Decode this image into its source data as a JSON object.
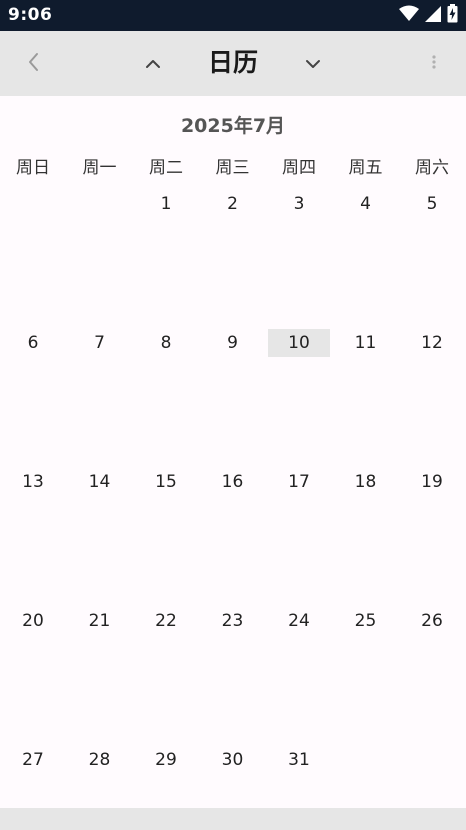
{
  "status_bar": {
    "time": "9:06",
    "icons": [
      "wifi-icon",
      "cellular-signal-icon",
      "battery-charging-icon"
    ]
  },
  "toolbar": {
    "title": "日历",
    "back_icon": "chevron-left-icon",
    "prev_icon": "chevron-up-icon",
    "next_icon": "chevron-down-icon",
    "menu_icon": "more-vert-icon"
  },
  "calendar": {
    "month_title": "2025年7月",
    "weekdays": [
      "周日",
      "周一",
      "周二",
      "周三",
      "周四",
      "周五",
      "周六"
    ],
    "first_weekday_index": 2,
    "days_in_month": 31,
    "highlighted_day": 10,
    "weeks": [
      [
        "",
        "",
        "1",
        "2",
        "3",
        "4",
        "5"
      ],
      [
        "6",
        "7",
        "8",
        "9",
        "10",
        "11",
        "12"
      ],
      [
        "13",
        "14",
        "15",
        "16",
        "17",
        "18",
        "19"
      ],
      [
        "20",
        "21",
        "22",
        "23",
        "24",
        "25",
        "26"
      ],
      [
        "27",
        "28",
        "29",
        "30",
        "31",
        "",
        ""
      ]
    ]
  },
  "colors": {
    "status_bar_bg": "#0f1b2d",
    "toolbar_bg": "#e6e6e6",
    "page_bg": "#fffbfe",
    "highlight_bg": "#e6e6e6"
  }
}
